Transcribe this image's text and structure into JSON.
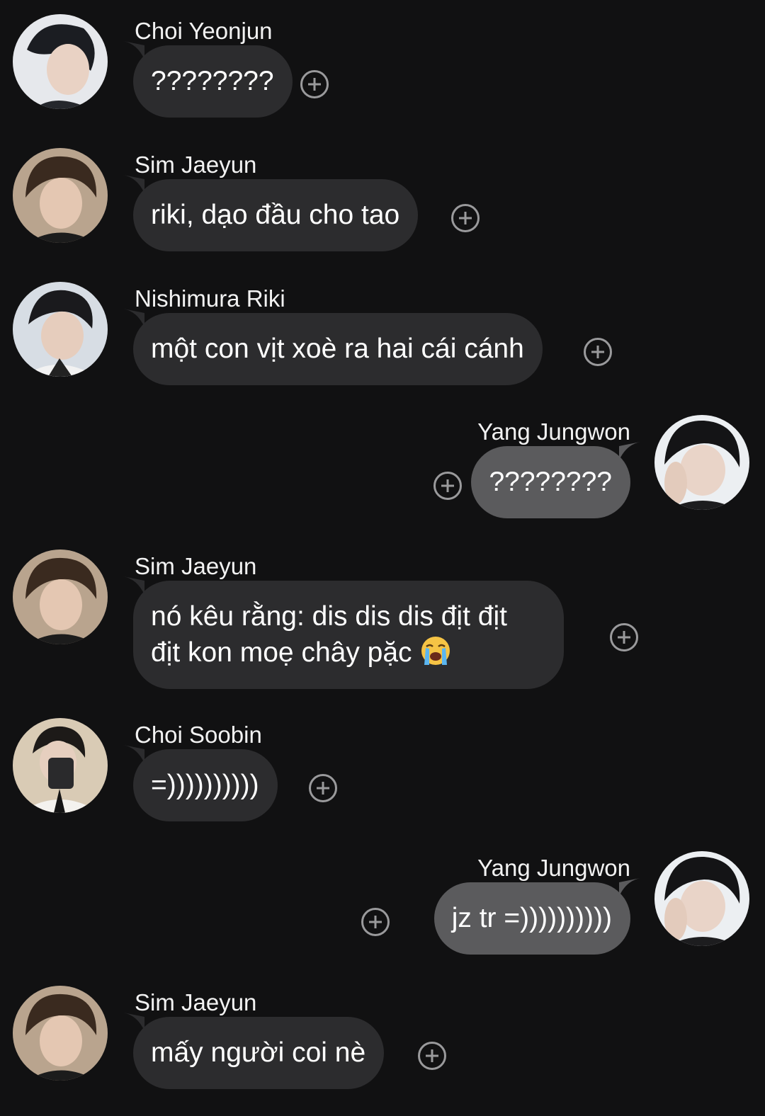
{
  "colors": {
    "background": "#111112",
    "incoming_bubble": "#2c2c2e",
    "outgoing_bubble": "#5b5b5d",
    "text": "#ffffff",
    "react_icon": "#9a9a9c"
  },
  "messages": [
    {
      "direction": "in",
      "sender": "Choi Yeonjun",
      "lines": [
        "????????"
      ],
      "avatar": "avatar-choi-yeonjun"
    },
    {
      "direction": "in",
      "sender": "Sim Jaeyun",
      "lines": [
        "riki, dạo đầu cho tao"
      ],
      "avatar": "avatar-sim-jaeyun"
    },
    {
      "direction": "in",
      "sender": "Nishimura Riki",
      "lines": [
        "một con vịt xoè ra hai cái cánh"
      ],
      "avatar": "avatar-nishimura-riki"
    },
    {
      "direction": "out",
      "sender": "Yang Jungwon",
      "lines": [
        "????????"
      ],
      "avatar": "avatar-yang-jungwon"
    },
    {
      "direction": "in",
      "sender": "Sim Jaeyun",
      "lines": [
        "nó kêu rằng: dis dis dis địt địt",
        "địt kon moẹ chây pặc"
      ],
      "emoji": "loudly-crying-face-icon",
      "avatar": "avatar-sim-jaeyun"
    },
    {
      "direction": "in",
      "sender": "Choi Soobin",
      "lines": [
        "=))))))))))"
      ],
      "avatar": "avatar-choi-soobin"
    },
    {
      "direction": "out",
      "sender": "Yang Jungwon",
      "lines": [
        "jz tr =))))))))))"
      ],
      "avatar": "avatar-yang-jungwon"
    },
    {
      "direction": "in",
      "sender": "Sim Jaeyun",
      "lines": [
        "mấy người coi nè"
      ],
      "avatar": "avatar-sim-jaeyun"
    }
  ]
}
